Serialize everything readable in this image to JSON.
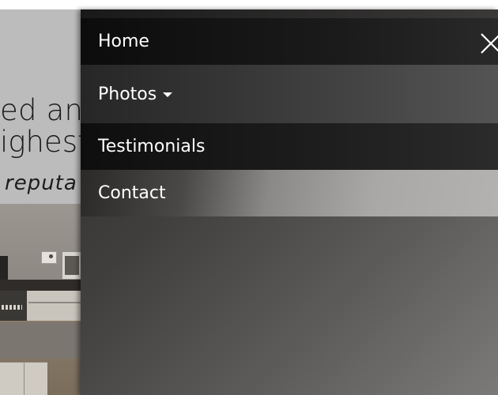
{
  "background_page": {
    "hero_line_1": "ed and",
    "hero_line_2": "ighest",
    "tagline": "reputa"
  },
  "menu": {
    "items": [
      {
        "label": "Home"
      },
      {
        "label": "Photos",
        "has_dropdown": true
      },
      {
        "label": "Testimonials"
      },
      {
        "label": "Contact"
      }
    ],
    "close_icon": "close-icon"
  },
  "colors": {
    "menu_text": "#ffffff",
    "menu_dark": "#0d0c0c",
    "menu_mid": "#3d3c3c",
    "menu_light": "#b3b2b1"
  }
}
